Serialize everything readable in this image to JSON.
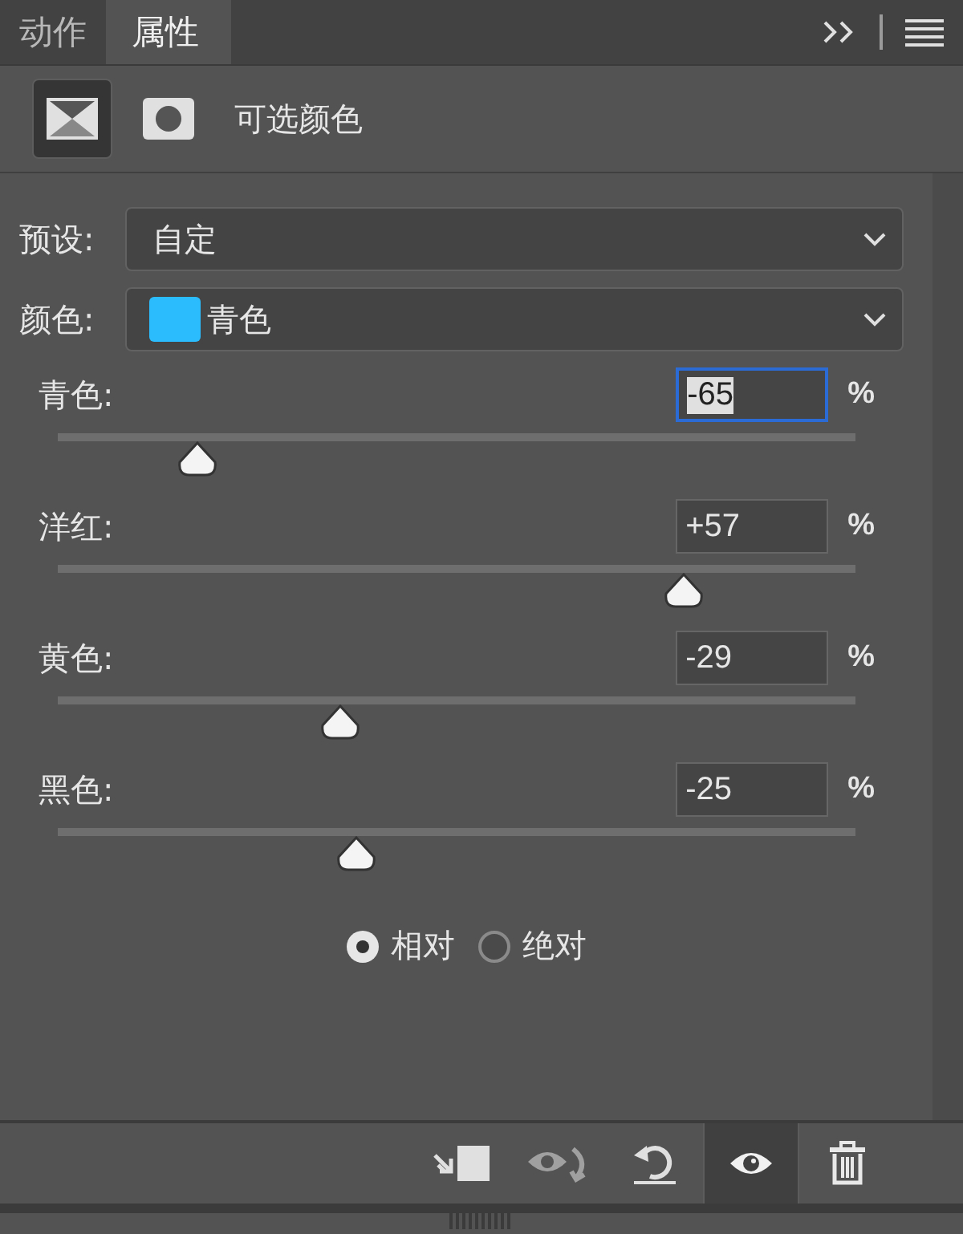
{
  "tabs": [
    {
      "label": "动作",
      "selected": false
    },
    {
      "label": "属性",
      "selected": true
    }
  ],
  "header": {
    "title": "可选颜色",
    "modes": [
      {
        "kind": "adjustment",
        "selected": true
      },
      {
        "kind": "mask",
        "selected": false
      }
    ]
  },
  "preset": {
    "label": "预设:",
    "value": "自定"
  },
  "color": {
    "label": "颜色:",
    "value": "青色",
    "color": "#2bbcfd"
  },
  "sliders": [
    {
      "label": "青色:",
      "value": "-65",
      "unit": "%",
      "level": 0.175,
      "focused": true
    },
    {
      "label": "洋红:",
      "value": "+57",
      "unit": "%",
      "level": 0.785,
      "focused": false
    },
    {
      "label": "黄色:",
      "value": "-29",
      "unit": "%",
      "level": 0.355,
      "focused": false
    },
    {
      "label": "黑色:",
      "value": "-25",
      "unit": "%",
      "level": 0.375,
      "focused": false
    }
  ],
  "method": [
    {
      "label": "相对",
      "selected": true
    },
    {
      "label": "绝对",
      "selected": false
    }
  ],
  "toolbar": [
    {
      "kind": "clip",
      "selected": false,
      "disabled": false
    },
    {
      "kind": "view-previous",
      "selected": false,
      "disabled": true
    },
    {
      "kind": "reset",
      "selected": false,
      "disabled": false
    },
    {
      "kind": "visibility",
      "selected": true,
      "disabled": false
    },
    {
      "kind": "delete",
      "selected": false,
      "disabled": false
    }
  ]
}
